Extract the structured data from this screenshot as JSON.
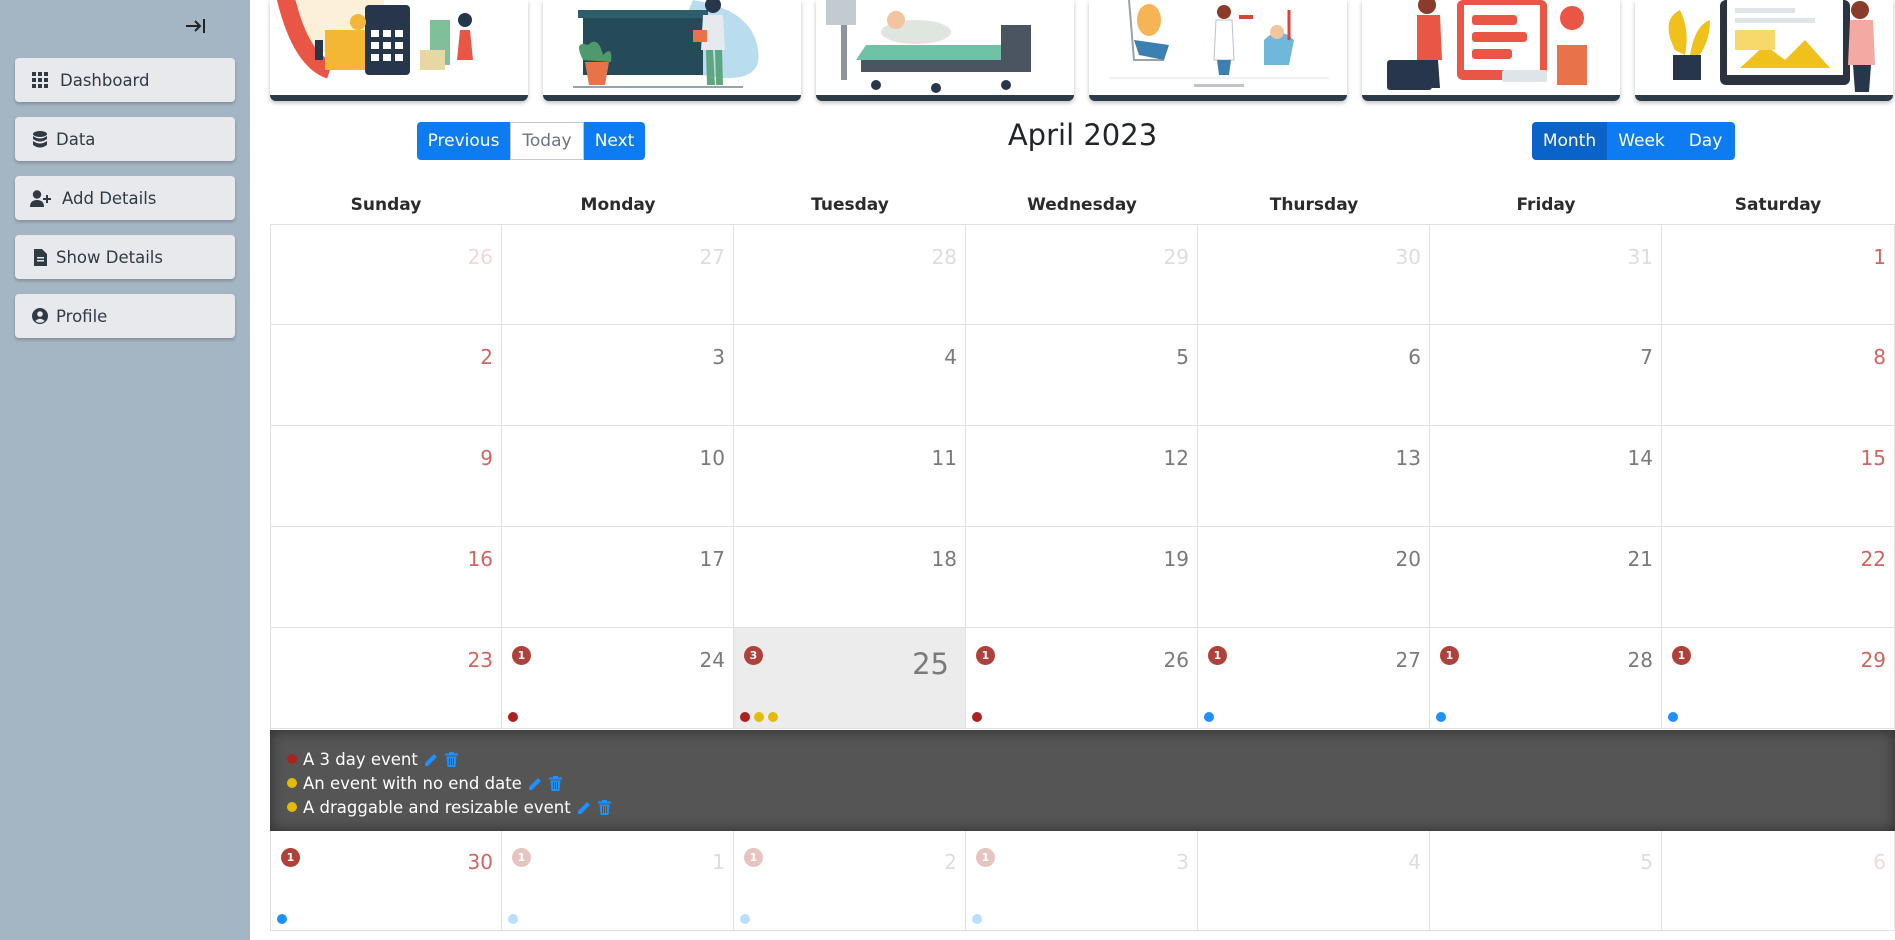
{
  "sidebar": {
    "items": [
      {
        "label": "Dashboard",
        "icon": "grid-icon"
      },
      {
        "label": "Data",
        "icon": "database-icon"
      },
      {
        "label": "Add Details",
        "icon": "user-plus-icon"
      },
      {
        "label": "Show Details",
        "icon": "file-icon"
      },
      {
        "label": "Profile",
        "icon": "user-circle-icon"
      }
    ]
  },
  "toolbar": {
    "previous_label": "Previous",
    "today_label": "Today",
    "next_label": "Next",
    "month_label": "Month",
    "week_label": "Week",
    "day_label": "Day",
    "view_active": "Month"
  },
  "calendar": {
    "title": "April 2023",
    "weekdays": [
      "Sunday",
      "Monday",
      "Tuesday",
      "Wednesday",
      "Thursday",
      "Friday",
      "Saturday"
    ],
    "weeks": [
      [
        {
          "day": "26",
          "out": true
        },
        {
          "day": "27",
          "out": true
        },
        {
          "day": "28",
          "out": true
        },
        {
          "day": "29",
          "out": true
        },
        {
          "day": "30",
          "out": true
        },
        {
          "day": "31",
          "out": true
        },
        {
          "day": "1"
        }
      ],
      [
        {
          "day": "2"
        },
        {
          "day": "3"
        },
        {
          "day": "4"
        },
        {
          "day": "5"
        },
        {
          "day": "6"
        },
        {
          "day": "7"
        },
        {
          "day": "8"
        }
      ],
      [
        {
          "day": "9"
        },
        {
          "day": "10"
        },
        {
          "day": "11"
        },
        {
          "day": "12"
        },
        {
          "day": "13"
        },
        {
          "day": "14"
        },
        {
          "day": "15"
        }
      ],
      [
        {
          "day": "16"
        },
        {
          "day": "17"
        },
        {
          "day": "18"
        },
        {
          "day": "19"
        },
        {
          "day": "20"
        },
        {
          "day": "21"
        },
        {
          "day": "22"
        }
      ],
      [
        {
          "day": "23"
        },
        {
          "day": "24",
          "badge": "1",
          "dots": [
            "red"
          ]
        },
        {
          "day": "25",
          "today": true,
          "badge": "3",
          "dots": [
            "red",
            "yellow",
            "yellow"
          ]
        },
        {
          "day": "26",
          "badge": "1",
          "dots": [
            "red"
          ]
        },
        {
          "day": "27",
          "badge": "1",
          "dots": [
            "blue"
          ]
        },
        {
          "day": "28",
          "badge": "1",
          "dots": [
            "blue"
          ]
        },
        {
          "day": "29",
          "badge": "1",
          "dots": [
            "blue"
          ]
        }
      ],
      [
        {
          "day": "30",
          "badge": "1",
          "dots": [
            "blue"
          ]
        },
        {
          "day": "1",
          "out": true,
          "badge": "1",
          "dots": [
            "blue"
          ]
        },
        {
          "day": "2",
          "out": true,
          "badge": "1",
          "dots": [
            "blue"
          ]
        },
        {
          "day": "3",
          "out": true,
          "badge": "1",
          "dots": [
            "blue"
          ]
        },
        {
          "day": "4",
          "out": true
        },
        {
          "day": "5",
          "out": true
        },
        {
          "day": "6",
          "out": true
        }
      ]
    ],
    "expanded_events": [
      {
        "title": "A 3 day event",
        "color": "red"
      },
      {
        "title": "An event with no end date",
        "color": "yellow"
      },
      {
        "title": "A draggable and resizable event",
        "color": "yellow"
      }
    ]
  },
  "colors": {
    "red": "#ad2121",
    "yellow": "#e3bc08",
    "blue": "#1e90ff",
    "primary": "#0d7cf2",
    "primary_active": "#0a63c9",
    "sidebar_bg": "#a4b6c3"
  },
  "illustrations": [
    "finance-illustration",
    "reception-illustration",
    "hospital-bed-illustration",
    "clinic-illustration",
    "mobile-payment-illustration",
    "tablet-illustration"
  ]
}
